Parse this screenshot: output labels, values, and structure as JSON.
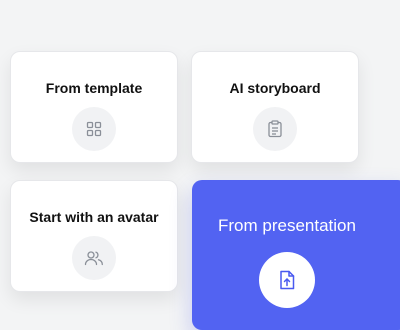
{
  "cards": [
    {
      "title": "From template",
      "icon": "grid-icon"
    },
    {
      "title": "AI storyboard",
      "icon": "clipboard-icon"
    },
    {
      "title": "Start with an avatar",
      "icon": "users-icon"
    },
    {
      "title": "From presentation",
      "icon": "file-upload-icon"
    }
  ],
  "colors": {
    "accent": "#5263f2",
    "card_bg": "#ffffff",
    "page_bg": "#f3f4f5",
    "icon_gray": "#8a8f98"
  }
}
